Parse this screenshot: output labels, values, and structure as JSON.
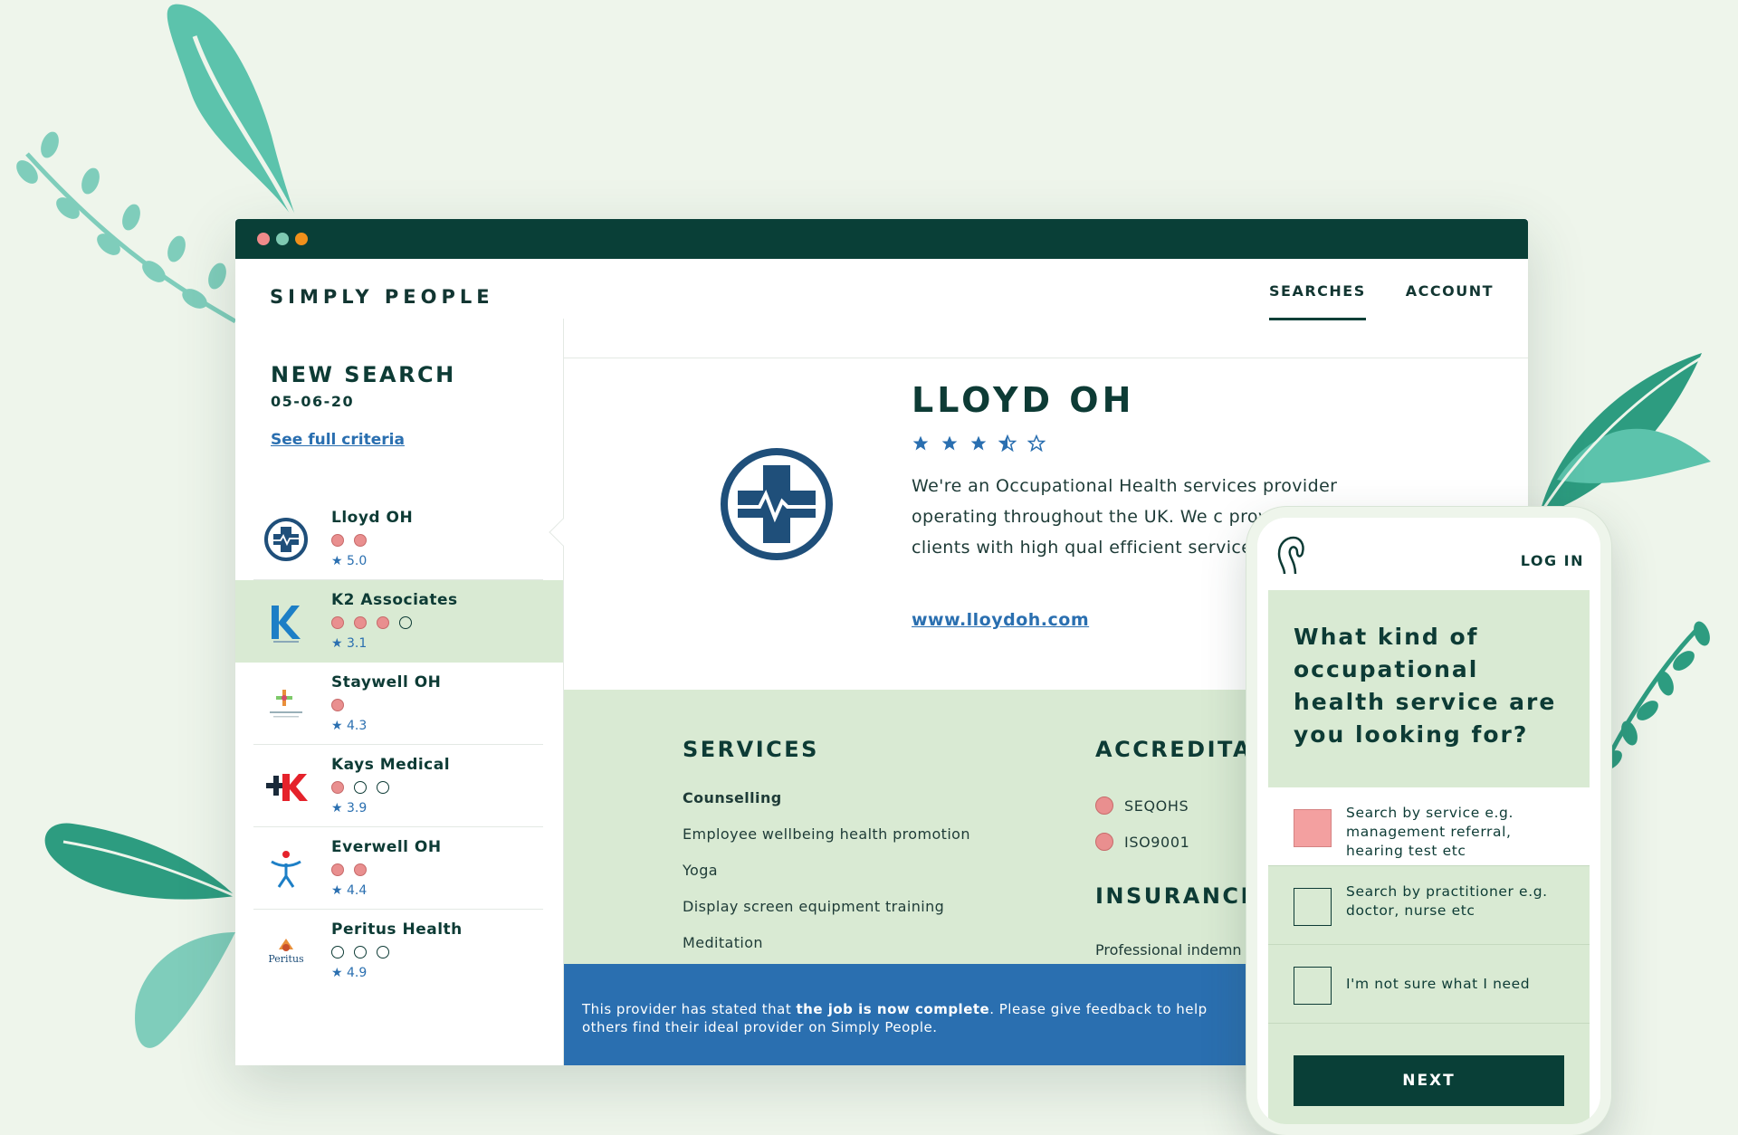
{
  "colors": {
    "dark_green": "#093f37",
    "light_green": "#d9ead3",
    "pink": "#e98f8f",
    "blue": "#2a6fb0",
    "leaf_teal": "#5cc3ac",
    "leaf_dark": "#2d9c80"
  },
  "header": {
    "brand": "SIMPLY PEOPLE",
    "nav": [
      "SEARCHES",
      "ACCOUNT"
    ]
  },
  "sidebar": {
    "title": "NEW SEARCH",
    "date": "05-06-20",
    "criteria_link": "See full criteria",
    "providers": [
      {
        "name": "Lloyd OH",
        "dots_filled": 2,
        "dots_total": 2,
        "rating": "5.0",
        "logo": "lloyd-cross-icon"
      },
      {
        "name": "K2 Associates",
        "dots_filled": 3,
        "dots_total": 4,
        "rating": "3.1",
        "logo": "k2-logo-icon"
      },
      {
        "name": "Staywell OH",
        "dots_filled": 1,
        "dots_total": 1,
        "rating": "4.3",
        "logo": "staywell-logo-icon"
      },
      {
        "name": "Kays Medical",
        "dots_filled": 1,
        "dots_total": 3,
        "rating": "3.9",
        "logo": "kays-logo-icon"
      },
      {
        "name": "Everwell OH",
        "dots_filled": 2,
        "dots_total": 2,
        "rating": "4.4",
        "logo": "everwell-logo-icon"
      },
      {
        "name": "Peritus Health",
        "dots_filled": 0,
        "dots_total": 3,
        "rating": "4.9",
        "logo": "peritus-logo-icon"
      }
    ]
  },
  "main": {
    "title": "LLOYD OH",
    "rating_stars": 3.5,
    "description": "We're an Occupational Health services provider operating throughout the UK. We c provide our clients with high qual efficient services.",
    "website": "www.lloydoh.com",
    "services_title": "SERVICES",
    "services": [
      "Counselling",
      "Employee wellbeing health promotion",
      "Yoga",
      "Display screen equipment training",
      "Meditation"
    ],
    "accreditations_title": "ACCREDITA",
    "accreditations": [
      "SEQOHS",
      "ISO9001"
    ],
    "insurance_title": "INSURANCE",
    "insurance_item": "Professional indemn",
    "banner_part1": "This provider has stated that ",
    "banner_bold": "the job is now complete",
    "banner_part2": ". Please give feedback to help others find their ideal provider on Simply People."
  },
  "phone": {
    "login": "LOG IN",
    "question": "What kind of occupational health service are you looking for?",
    "options": [
      {
        "label": "Search by service e.g. management referral, hearing test etc",
        "checked": true
      },
      {
        "label": "Search by practitioner e.g. doctor, nurse etc",
        "checked": false
      },
      {
        "label": "I'm not sure what I need",
        "checked": false
      }
    ],
    "next": "NEXT"
  }
}
